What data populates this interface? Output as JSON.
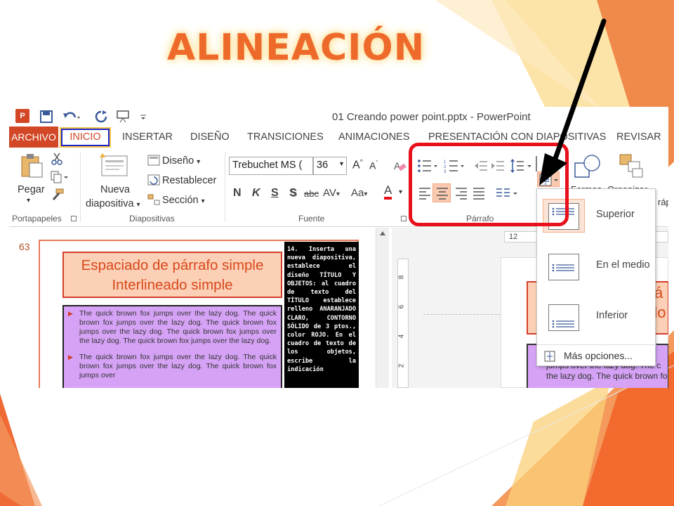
{
  "slide": {
    "title": "ALINEACIÓN"
  },
  "window": {
    "title": "01 Creando power point.pptx - PowerPoint"
  },
  "tabs": [
    "ARCHIVO",
    "INICIO",
    "INSERTAR",
    "DISEÑO",
    "TRANSICIONES",
    "ANIMACIONES",
    "PRESENTACIÓN CON DIAPOSITIVAS",
    "REVISAR"
  ],
  "ribbon": {
    "clipboard": {
      "paste": "Pegar",
      "label": "Portapapeles"
    },
    "slides": {
      "new_line1": "Nueva",
      "new_line2": "diapositiva",
      "layout": "Diseño",
      "reset": "Restablecer",
      "section": "Sección",
      "label": "Diapositivas"
    },
    "font": {
      "name": "Trebuchet MS (",
      "size": "36",
      "bold": "N",
      "italic": "K",
      "underline": "S",
      "shadow": "S",
      "strike": "abc",
      "spacing": "AV",
      "case": "Aa",
      "color": "A",
      "label": "Fuente"
    },
    "paragraph": {
      "label": "Párrafo"
    },
    "drawing": {
      "shapes": "Formas",
      "arrange": "Organizar",
      "partial": "rápi"
    }
  },
  "thumbnail": {
    "number": "63",
    "title_line1": "Espaciado de párrafo simple",
    "title_line2": "Interlineado simple",
    "para1": "The quick brown fox jumps over the lazy dog. The quick brown fox jumps over the lazy dog. The quick brown fox jumps over the lazy dog. The quick brown fox jumps over the lazy dog. The quick brown fox jumps over the lazy dog.",
    "para2": "The quick brown fox jumps over the lazy dog. The quick brown fox jumps over the lazy dog. The quick brown fox jumps over",
    "note": "14. Inserta una nueva diapositiva, establece el diseño TÍTULO Y OBJETOS: al cuadro de texto del TÍTULO establece relleno ANARANJADO CLARO, CONTORNO SÓLIDO de 3 ptos., color ROJO. En el cuadro de texto de los objetos, escribe la indicación"
  },
  "editor": {
    "ruler_h": "12",
    "ruler_v": [
      "8",
      "6",
      "4",
      "2"
    ],
    "title_partial_1": "á",
    "title_partial_2": "do",
    "body_line1": "jumps over the lazy dog. The c",
    "body_line2": "the lazy dog. The quick brown fo"
  },
  "menu": {
    "items": [
      "Superior",
      "En el medio",
      "Inferior"
    ],
    "more": "Más opciones..."
  },
  "colors": {
    "accent": "#d24726",
    "highlight": "#e8101b",
    "arrow": "#000000"
  }
}
